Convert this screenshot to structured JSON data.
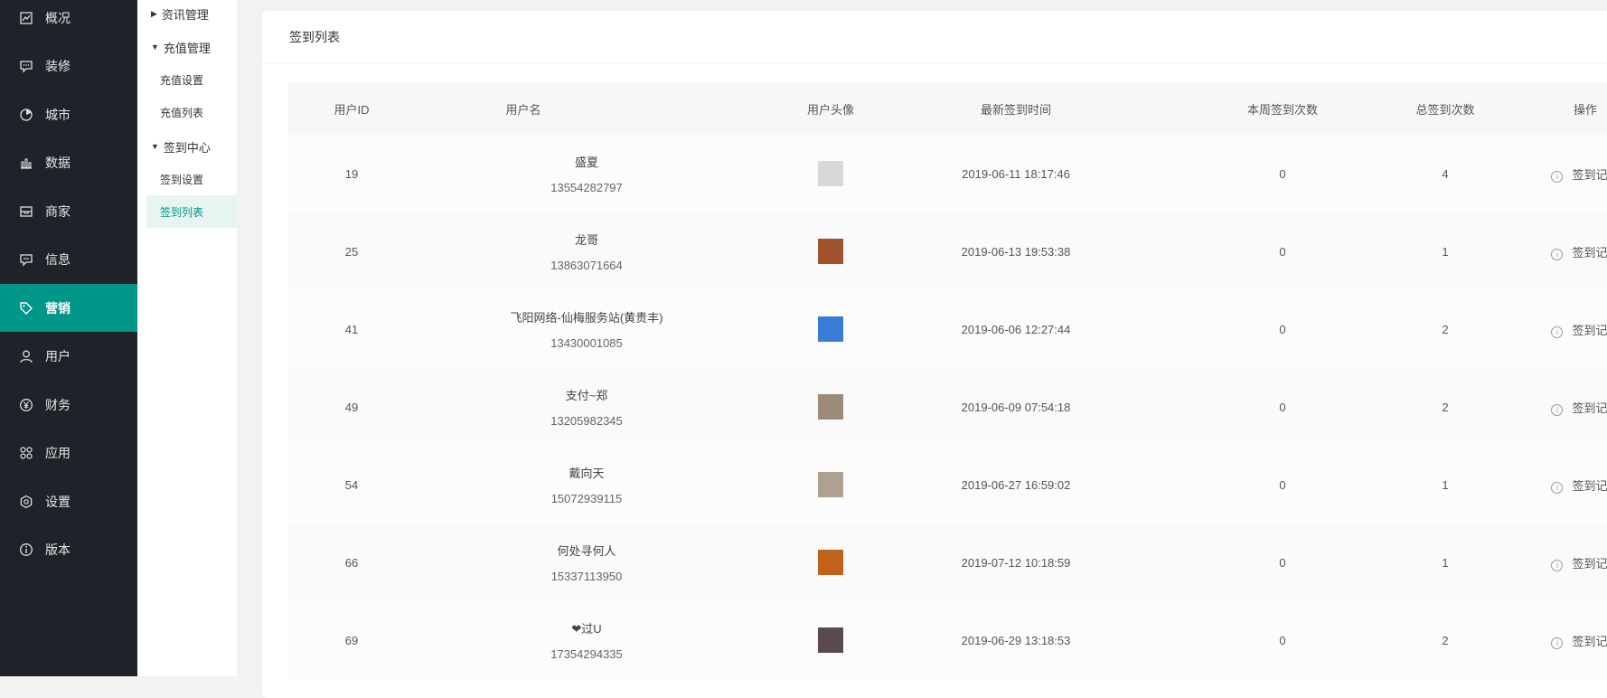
{
  "sidebar": {
    "items": [
      {
        "label": "概况",
        "icon": "overview-icon",
        "active": false
      },
      {
        "label": "装修",
        "icon": "decoration-icon",
        "active": false
      },
      {
        "label": "城市",
        "icon": "city-icon",
        "active": false
      },
      {
        "label": "数据",
        "icon": "data-icon",
        "active": false
      },
      {
        "label": "商家",
        "icon": "merchant-icon",
        "active": false
      },
      {
        "label": "信息",
        "icon": "message-icon",
        "active": false
      },
      {
        "label": "营销",
        "icon": "tag-icon",
        "active": true
      },
      {
        "label": "用户",
        "icon": "user-icon",
        "active": false
      },
      {
        "label": "财务",
        "icon": "yen-icon",
        "active": false
      },
      {
        "label": "应用",
        "icon": "apps-icon",
        "active": false
      },
      {
        "label": "设置",
        "icon": "gear-icon",
        "active": false
      },
      {
        "label": "版本",
        "icon": "info-icon",
        "active": false
      }
    ]
  },
  "subnav": {
    "news": "资讯管理",
    "recharge": "充值管理",
    "recharge_settings": "充值设置",
    "recharge_list": "充值列表",
    "checkin": "签到中心",
    "checkin_settings": "签到设置",
    "checkin_list": "签到列表"
  },
  "card": {
    "title": "签到列表"
  },
  "table": {
    "headers": {
      "uid": "用户ID",
      "name": "用户名",
      "avatar": "用户头像",
      "latest": "最新签到时间",
      "week": "本周签到次数",
      "total": "总签到次数",
      "op": "操作"
    },
    "op_label": "签到记录",
    "rows": [
      {
        "id": "19",
        "name": "盛夏",
        "phone": "13554282797",
        "latest": "2019-06-11 18:17:46",
        "week": "0",
        "total": "4",
        "avatar_color": "#d8d8d8"
      },
      {
        "id": "25",
        "name": "龙哥",
        "phone": "13863071664",
        "latest": "2019-06-13 19:53:38",
        "week": "0",
        "total": "1",
        "avatar_color": "#a0522d"
      },
      {
        "id": "41",
        "name": "飞阳网络-仙梅服务站(黄贵丰)",
        "phone": "13430001085",
        "latest": "2019-06-06 12:27:44",
        "week": "0",
        "total": "2",
        "avatar_color": "#3a7bd5"
      },
      {
        "id": "49",
        "name": "支付~郑",
        "phone": "13205982345",
        "latest": "2019-06-09 07:54:18",
        "week": "0",
        "total": "2",
        "avatar_color": "#9e8a78"
      },
      {
        "id": "54",
        "name": "戴向天",
        "phone": "15072939115",
        "latest": "2019-06-27 16:59:02",
        "week": "0",
        "total": "1",
        "avatar_color": "#b0a090"
      },
      {
        "id": "66",
        "name": "何处寻何人",
        "phone": "15337113950",
        "latest": "2019-07-12 10:18:59",
        "week": "0",
        "total": "1",
        "avatar_color": "#c0621a"
      },
      {
        "id": "69",
        "name": "❤过U",
        "phone": "17354294335",
        "latest": "2019-06-29 13:18:53",
        "week": "0",
        "total": "2",
        "avatar_color": "#5a4a50"
      }
    ]
  }
}
